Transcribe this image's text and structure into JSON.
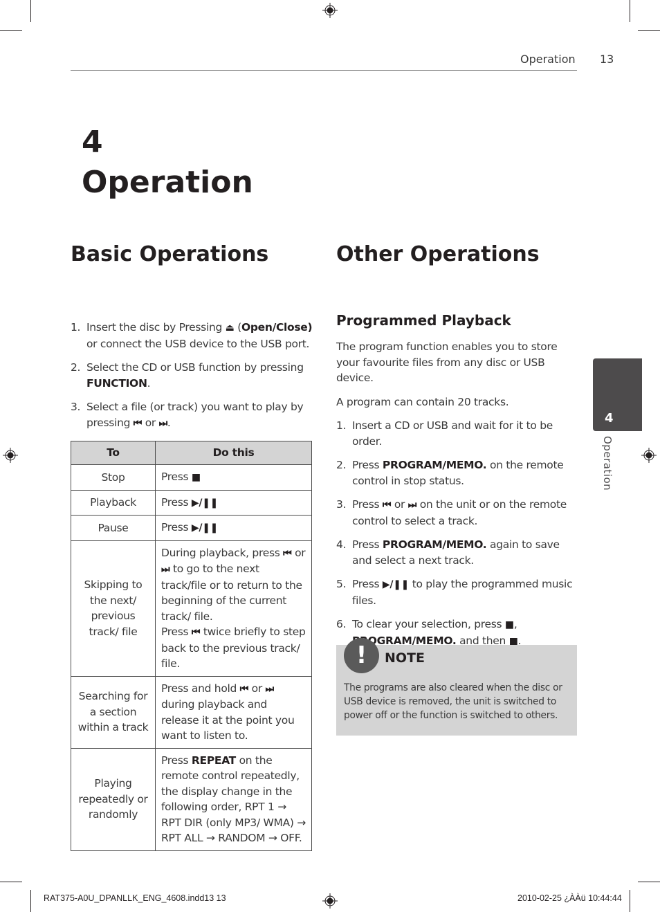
{
  "header": {
    "section_title": "Operation",
    "page_number": "13"
  },
  "chapter": {
    "number": "4",
    "title": "Operation"
  },
  "basic_operations": {
    "title": "Basic Operations",
    "steps": [
      {
        "num": "1.",
        "parts": [
          {
            "t": "Insert the disc by Pressing "
          },
          {
            "icon": "eject",
            "glyph": "⏏"
          },
          {
            "t": " ("
          },
          {
            "b": "Open/Close)"
          },
          {
            "t": " or connect the USB device to the USB port."
          }
        ]
      },
      {
        "num": "2.",
        "parts": [
          {
            "t": "Select the CD or USB function by pressing "
          },
          {
            "b": "FUNCTION"
          },
          {
            "t": "."
          }
        ]
      },
      {
        "num": "3.",
        "parts": [
          {
            "t": "Select a file (or track) you want to play by pressing "
          },
          {
            "icon": "skip-back",
            "glyph": "⏮"
          },
          {
            "t": " or "
          },
          {
            "icon": "skip-forward",
            "glyph": "⏭"
          },
          {
            "t": "."
          }
        ]
      }
    ],
    "table": {
      "headers": [
        "To",
        "Do this"
      ],
      "rows": [
        {
          "to": "Stop",
          "do": [
            {
              "t": "Press "
            },
            {
              "icon": "stop",
              "glyph": "■"
            }
          ]
        },
        {
          "to": "Playback",
          "do": [
            {
              "t": "Press "
            },
            {
              "icon": "play-pause",
              "glyph": "▶/❚❚"
            }
          ]
        },
        {
          "to": "Pause",
          "do": [
            {
              "t": "Press "
            },
            {
              "icon": "play-pause",
              "glyph": "▶/❚❚"
            }
          ]
        },
        {
          "to": "Skipping to the next/ previous track/ file",
          "do": [
            {
              "t": "During playback, press "
            },
            {
              "icon": "skip-back",
              "glyph": "⏮"
            },
            {
              "t": " or "
            },
            {
              "icon": "skip-forward",
              "glyph": "⏭"
            },
            {
              "t": " to go to the next track/file or to return to the beginning of the current track/ file."
            },
            {
              "br": true
            },
            {
              "t": "Press "
            },
            {
              "icon": "skip-back",
              "glyph": "⏮"
            },
            {
              "t": " twice briefly to step back to the previous track/ file."
            }
          ]
        },
        {
          "to": "Searching for a section within a track",
          "do": [
            {
              "t": "Press and hold "
            },
            {
              "icon": "skip-back",
              "glyph": "⏮"
            },
            {
              "t": " or "
            },
            {
              "icon": "skip-forward",
              "glyph": "⏭"
            },
            {
              "t": " during playback and release it at the point you want to listen to."
            }
          ]
        },
        {
          "to": "Playing repeatedly or randomly",
          "do": [
            {
              "t": "Press "
            },
            {
              "b": "REPEAT"
            },
            {
              "t": " on the remote control repeatedly, the display change in the following order, RPT 1 → RPT DIR (only MP3/ WMA) → RPT ALL → RANDOM → OFF."
            }
          ]
        }
      ]
    }
  },
  "other_operations": {
    "title": "Other Operations",
    "subsection_title": "Programmed Playback",
    "intro": [
      "The program function enables you to store your favourite files from any disc or USB device.",
      "A program can contain 20 tracks."
    ],
    "steps": [
      {
        "num": "1.",
        "parts": [
          {
            "t": "Insert a CD or USB and wait for it to be order."
          }
        ]
      },
      {
        "num": "2.",
        "parts": [
          {
            "t": "Press "
          },
          {
            "b": "PROGRAM/MEMO."
          },
          {
            "t": " on the remote control in stop status."
          }
        ]
      },
      {
        "num": "3.",
        "parts": [
          {
            "t": "Press "
          },
          {
            "icon": "skip-back",
            "glyph": "⏮"
          },
          {
            "t": " or "
          },
          {
            "icon": "skip-forward",
            "glyph": "⏭"
          },
          {
            "t": " on the unit or on the remote control to select a track."
          }
        ]
      },
      {
        "num": "4.",
        "parts": [
          {
            "t": "Press "
          },
          {
            "b": "PROGRAM/MEMO."
          },
          {
            "t": " again to save and select a next track."
          }
        ]
      },
      {
        "num": "5.",
        "parts": [
          {
            "t": "Press "
          },
          {
            "icon": "play-pause",
            "glyph": "▶/❚❚"
          },
          {
            "t": " to play the programmed music files."
          }
        ]
      },
      {
        "num": "6.",
        "parts": [
          {
            "t": "To clear your selection, press "
          },
          {
            "icon": "stop",
            "glyph": "■"
          },
          {
            "t": ", "
          },
          {
            "b": "PROGRAM/MEMO."
          },
          {
            "t": " and then "
          },
          {
            "icon": "stop",
            "glyph": "■"
          },
          {
            "t": "."
          }
        ]
      }
    ],
    "note": {
      "icon_glyph": "!",
      "title": "NOTE",
      "text": "The programs are also cleared when the disc or USB device is removed, the unit is switched to power off or the function is switched to others."
    }
  },
  "side_tab": {
    "number": "4",
    "label": "Operation"
  },
  "footer": {
    "left": "RAT375-A0U_DPANLLK_ENG_4608.indd13   13",
    "right": "2010-02-25   ¿ÀÀü 10:44:44"
  },
  "colors": {
    "text": "#231f20",
    "body": "#3a3a3a",
    "table_header_bg": "#d4d4d4",
    "note_bg": "#d4d4d4",
    "side_tab_bg": "#4d4b4c"
  }
}
